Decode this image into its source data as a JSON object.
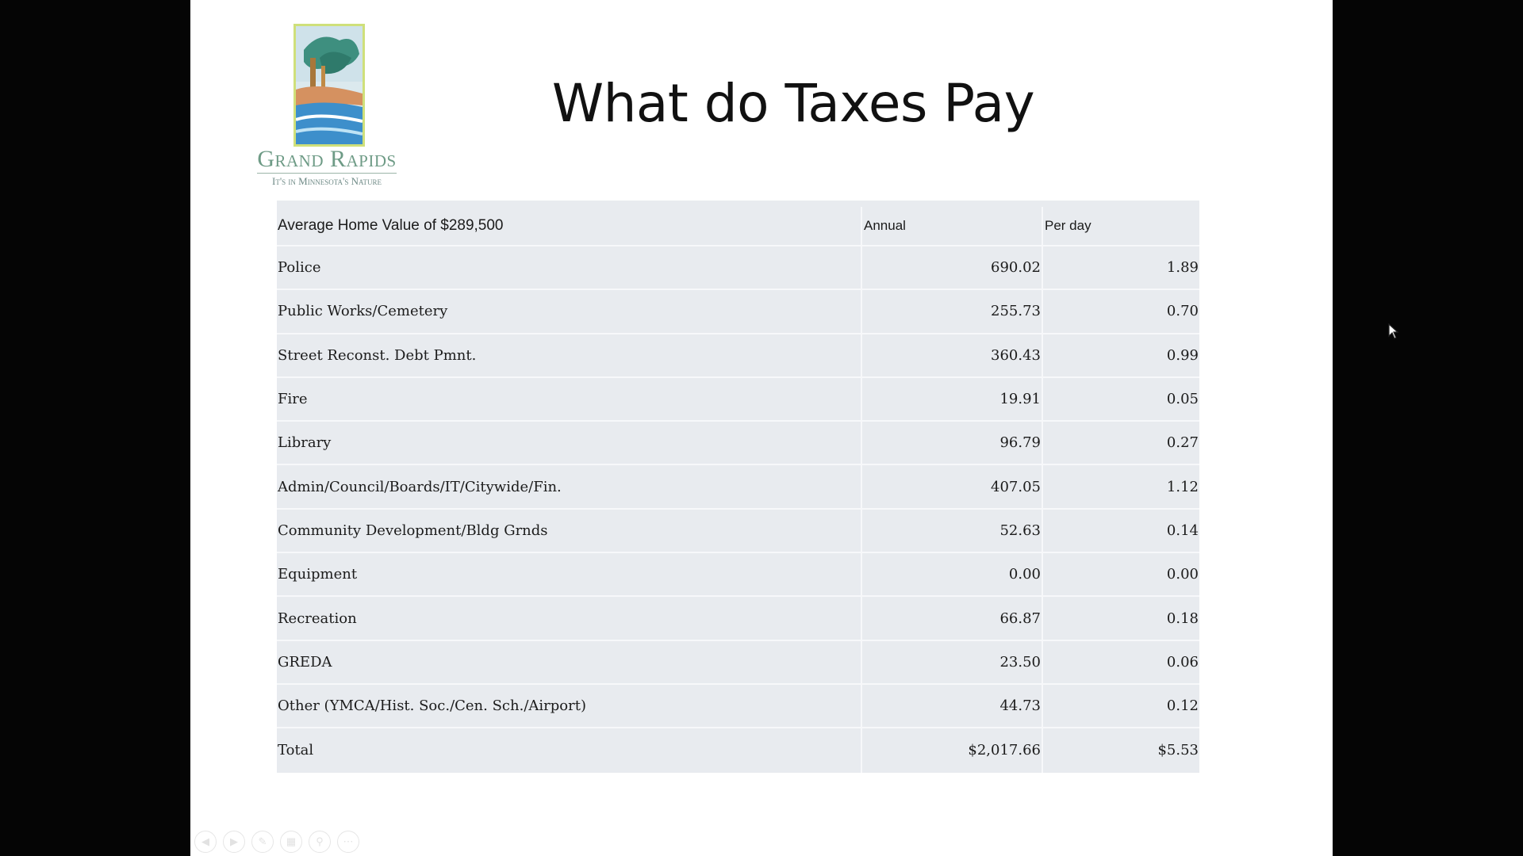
{
  "slide": {
    "title": "What do Taxes Pay",
    "logo": {
      "name": "Grand Rapids",
      "tagline": "It's in Minnesota's Nature"
    }
  },
  "table": {
    "header": {
      "label": "Average Home Value of $289,500",
      "annual": "Annual",
      "per_day": "Per day"
    },
    "rows": [
      {
        "label": "Police",
        "annual": "690.02",
        "per_day": "1.89"
      },
      {
        "label": "Public Works/Cemetery",
        "annual": "255.73",
        "per_day": "0.70"
      },
      {
        "label": "Street Reconst. Debt Pmnt.",
        "annual": "360.43",
        "per_day": "0.99"
      },
      {
        "label": "Fire",
        "annual": "19.91",
        "per_day": "0.05"
      },
      {
        "label": "Library",
        "annual": "96.79",
        "per_day": "0.27"
      },
      {
        "label": "Admin/Council/Boards/IT/Citywide/Fin.",
        "annual": "407.05",
        "per_day": "1.12"
      },
      {
        "label": "Community Development/Bldg Grnds",
        "annual": "52.63",
        "per_day": "0.14"
      },
      {
        "label": "Equipment",
        "annual": "0.00",
        "per_day": "0.00"
      },
      {
        "label": "Recreation",
        "annual": "66.87",
        "per_day": "0.18"
      },
      {
        "label": "GREDA",
        "annual": "23.50",
        "per_day": "0.06"
      },
      {
        "label": "Other (YMCA/Hist. Soc./Cen. Sch./Airport)",
        "annual": "44.73",
        "per_day": "0.12"
      },
      {
        "label": "Total",
        "annual": "$2,017.66",
        "per_day": "$5.53"
      }
    ]
  },
  "controls": [
    {
      "name": "previous-slide",
      "icon": "chevron-left-icon"
    },
    {
      "name": "next-slide",
      "icon": "chevron-right-icon"
    },
    {
      "name": "pen-tool",
      "icon": "pen-icon"
    },
    {
      "name": "see-all-slides",
      "icon": "slides-grid-icon"
    },
    {
      "name": "zoom",
      "icon": "magnifier-icon"
    },
    {
      "name": "more-options",
      "icon": "ellipsis-icon"
    }
  ],
  "colors": {
    "table_bg": "#e8ebef",
    "logo_green": "#6e9b86",
    "logo_frame": "#cfe07a"
  }
}
